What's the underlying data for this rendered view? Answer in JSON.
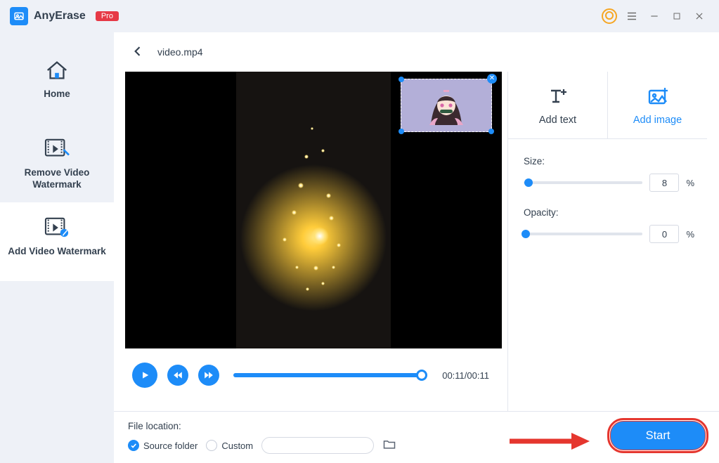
{
  "app": {
    "name": "AnyErase",
    "badge": "Pro"
  },
  "titlebar": {
    "account_icon": "account-icon",
    "menu_icon": "menu-icon",
    "minimize_icon": "minimize-icon",
    "maximize_icon": "maximize-icon",
    "close_icon": "close-icon"
  },
  "sidebar": {
    "items": [
      {
        "id": "home",
        "label": "Home",
        "icon": "home-icon"
      },
      {
        "id": "remove",
        "label": "Remove Video Watermark",
        "icon": "remove-watermark-icon"
      },
      {
        "id": "add",
        "label": "Add Video Watermark",
        "icon": "add-watermark-icon",
        "active": true
      }
    ]
  },
  "crumb": {
    "back_icon": "chevron-left-icon",
    "filename": "video.mp4"
  },
  "player": {
    "play_icon": "play-icon",
    "rewind_icon": "rewind-icon",
    "forward_icon": "forward-icon",
    "current": "00:11",
    "duration": "00:11"
  },
  "watermark_overlay": {
    "close_icon": "close-icon"
  },
  "right": {
    "modes": [
      {
        "id": "text",
        "label": "Add text",
        "icon": "add-text-icon"
      },
      {
        "id": "image",
        "label": "Add image",
        "icon": "add-image-icon",
        "active": true
      }
    ],
    "size": {
      "label": "Size:",
      "value": "8",
      "unit": "%"
    },
    "opacity": {
      "label": "Opacity:",
      "value": "0",
      "unit": "%"
    }
  },
  "bottom": {
    "file_location_label": "File location:",
    "options": [
      {
        "id": "source",
        "label": "Source folder",
        "checked": true
      },
      {
        "id": "custom",
        "label": "Custom",
        "checked": false
      }
    ],
    "browse_icon": "folder-open-icon",
    "start_label": "Start"
  },
  "colors": {
    "accent": "#1d8cf8",
    "annotation": "#e5362e"
  }
}
